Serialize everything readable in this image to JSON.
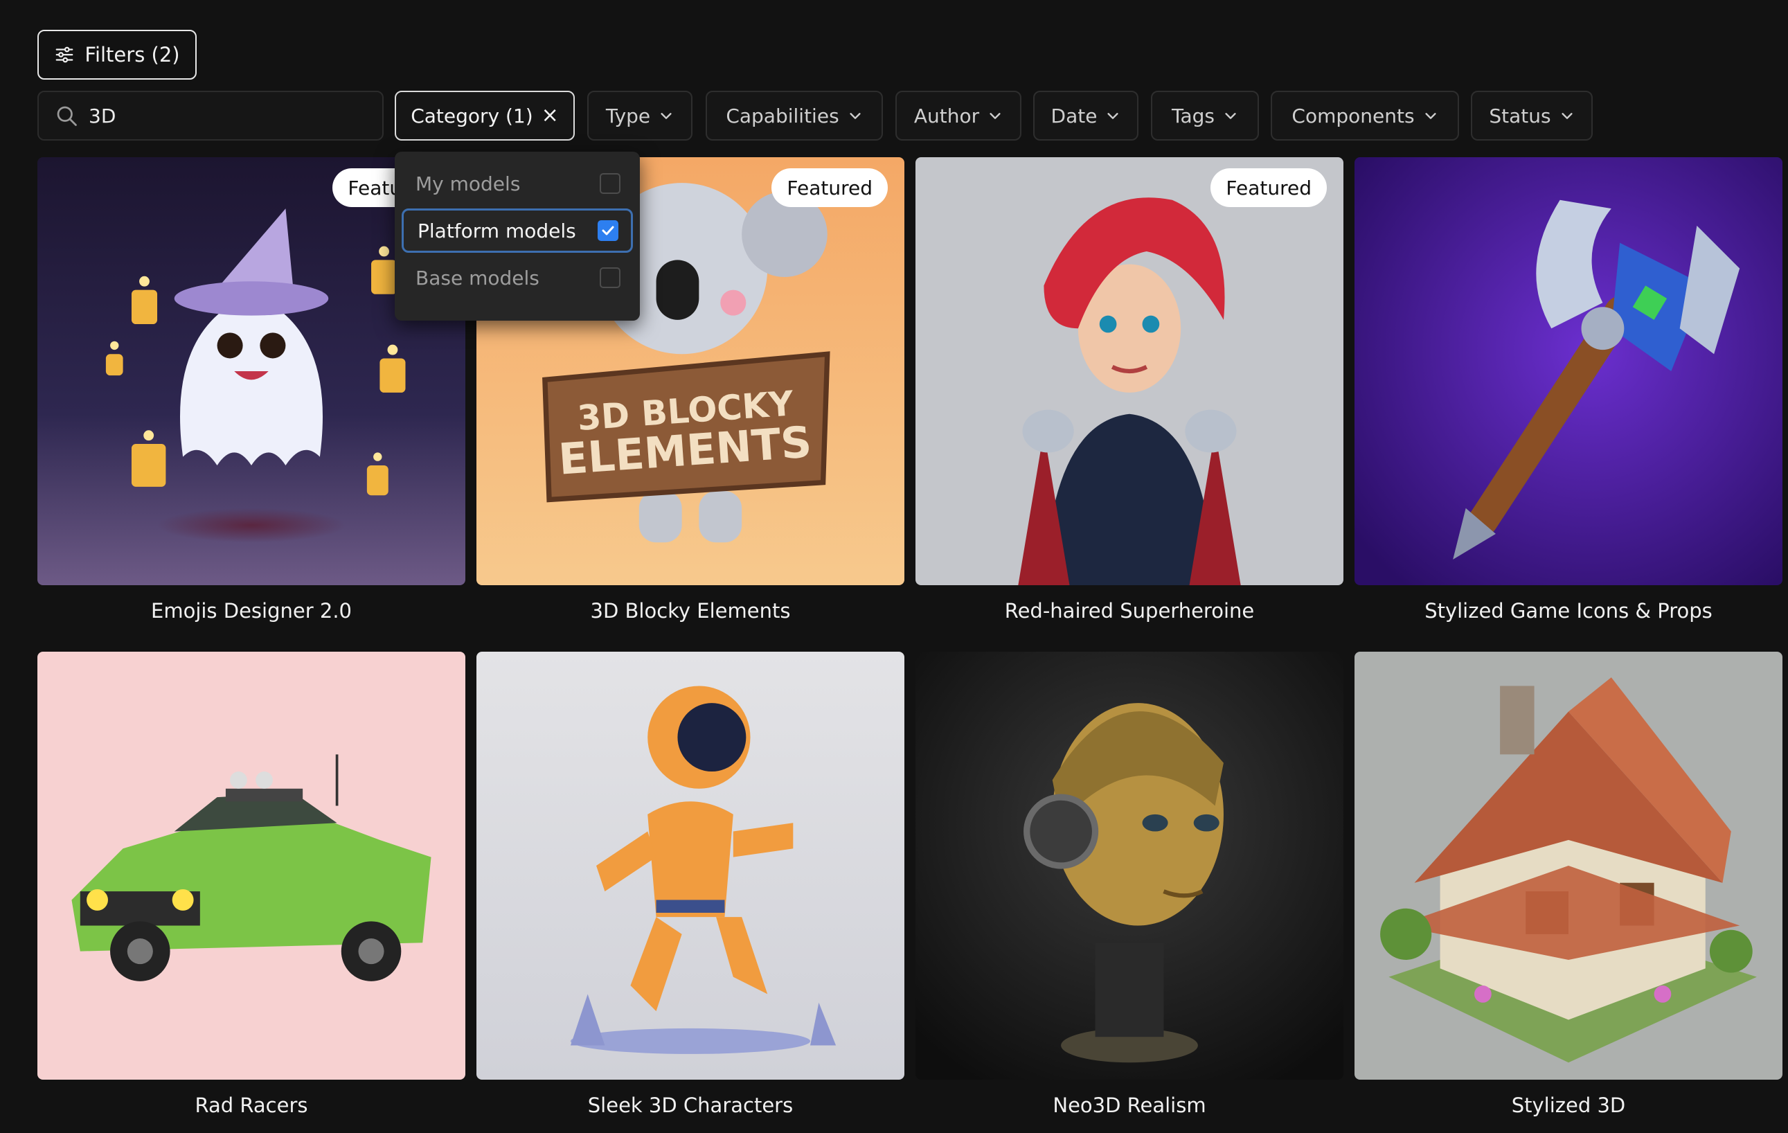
{
  "filters": {
    "label": "Filters (2)"
  },
  "search": {
    "value": "3D"
  },
  "chips": [
    {
      "label": "Category (1)",
      "active": true
    },
    {
      "label": "Type"
    },
    {
      "label": "Capabilities"
    },
    {
      "label": "Author"
    },
    {
      "label": "Date"
    },
    {
      "label": "Tags"
    },
    {
      "label": "Components"
    },
    {
      "label": "Status"
    }
  ],
  "category_options": [
    {
      "label": "My models",
      "checked": false
    },
    {
      "label": "Platform models",
      "checked": true
    },
    {
      "label": "Base models",
      "checked": false
    }
  ],
  "cards": [
    {
      "title": "Emojis Designer 2.0",
      "badge": "Featured"
    },
    {
      "title": "3D Blocky Elements",
      "badge": "Featured",
      "sign_text": [
        "3D BLOCKY",
        "ELEMENTS"
      ]
    },
    {
      "title": "Red-haired Superheroine",
      "badge": "Featured"
    },
    {
      "title": "Stylized Game Icons & Props",
      "badge": ""
    },
    {
      "title": "Rad Racers",
      "badge": ""
    },
    {
      "title": "Sleek 3D Characters",
      "badge": ""
    },
    {
      "title": "Neo3D Realism",
      "badge": ""
    },
    {
      "title": "Stylized 3D",
      "badge": ""
    }
  ],
  "colors": {
    "accent": "#2d7ff0",
    "background": "#121212"
  }
}
